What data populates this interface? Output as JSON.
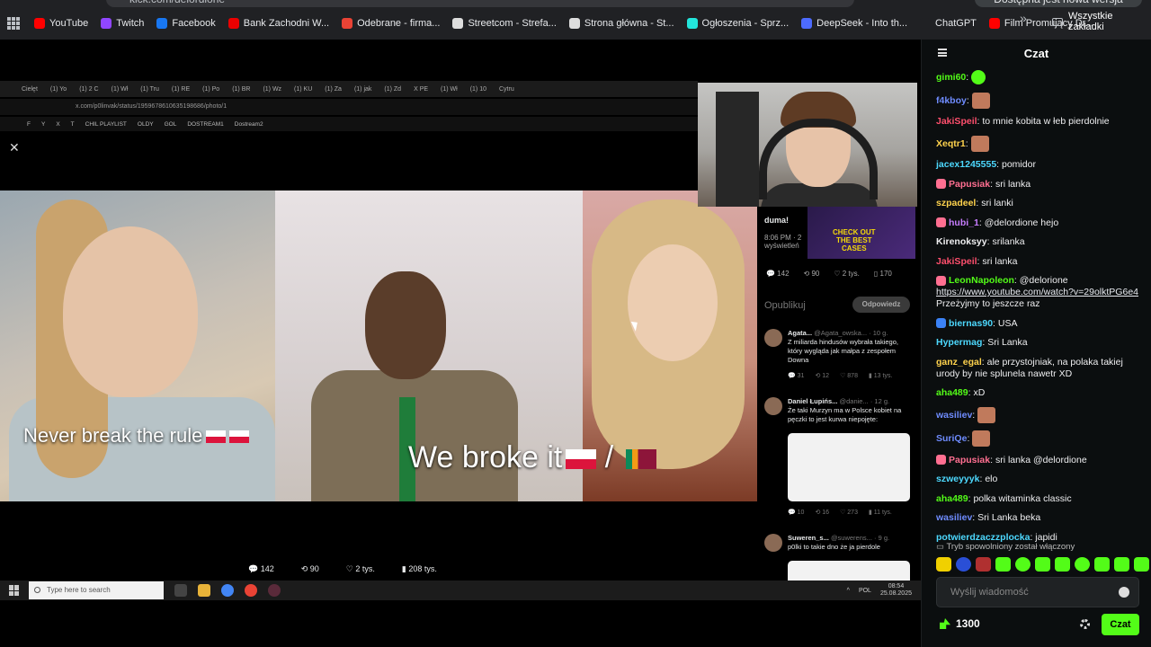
{
  "browser": {
    "url": "kick.com/delordione",
    "update_label": "Dostępna jest nowa wersja Chrome",
    "bookmarks": [
      {
        "label": "YouTube",
        "color": "#ff0000"
      },
      {
        "label": "Twitch",
        "color": "#9146ff"
      },
      {
        "label": "Facebook",
        "color": "#1877f2"
      },
      {
        "label": "Bank Zachodni W...",
        "color": "#ec0000"
      },
      {
        "label": "Odebrane - firma...",
        "color": "#ea4335"
      },
      {
        "label": "Streetcom - Strefa...",
        "color": "#dddddd"
      },
      {
        "label": "Strona główna - St...",
        "color": "#dddddd"
      },
      {
        "label": "Ogłoszenia - Sprz...",
        "color": "#23e5db"
      },
      {
        "label": "DeepSeek - Into th...",
        "color": "#4d6bfe"
      },
      {
        "label": "ChatGPT",
        "color": "#202124"
      },
      {
        "label": "Film Promujący Dr...",
        "color": "#ff0000"
      }
    ],
    "all_bookmarks": "Wszystkie zakładki"
  },
  "stream": {
    "inner_tabs": [
      "Cielęt",
      "(1) Yo",
      "(1) 2 C",
      "(1) Wł",
      "(1) Tru",
      "(1) RE",
      "(1) Po",
      "(1) BR",
      "(1) Wz",
      "(1) KU",
      "(1) Za",
      "(1) jak",
      "(1) Zd",
      "X PE",
      "(1) Wł",
      "(1) 10",
      "Cytru"
    ],
    "inner_url": "x.com/p0linvak/status/1959678610635198686/photo/1",
    "inner_bookmarks": [
      "F",
      "Y",
      "X",
      "T",
      "CHIL PLAYLIST",
      "OLDY",
      "GOL",
      "DOSTREAM1",
      "Dostream2"
    ],
    "caption_left": "Never break the rule",
    "caption_right": "We broke it",
    "tweet_side": {
      "text": "duma!",
      "time": "8:06 PM · 2",
      "views": "wyświetleń",
      "stats": [
        "142",
        "90",
        "2 tys.",
        "170"
      ],
      "publish": "Opublikuj",
      "reply_button": "Odpowiedz",
      "ad_text_1": "CHECK OUT",
      "ad_text_2": "THE BEST",
      "ad_text_3": "CASES"
    },
    "replies": [
      {
        "name": "Agata...",
        "handle": "@Agata_owska... · 10 g.",
        "text": "Z miliarda hindusów wybrała takiego, który wygląda jak małpa z zespołem Downa",
        "stats": [
          "31",
          "12",
          "878",
          "13 tys."
        ]
      },
      {
        "name": "Daniel Łupińs...",
        "handle": "@danie... · 12 g.",
        "text": "Że taki Murzyn ma w Polsce kobiet na pęczki to jest kurwa niepojęte:",
        "stats": [
          "10",
          "16",
          "273",
          "11 tys."
        ]
      },
      {
        "name": "Suweren_s...",
        "handle": "@suwerens... · 9 g.",
        "text": "p0lki to takie dno że ja pierdole",
        "stats": []
      }
    ],
    "bottom_stats": [
      "142",
      "90",
      "2 tys.",
      "208 tys."
    ],
    "taskbar": {
      "search_placeholder": "Type here to search",
      "lang": "POL",
      "time": "08:54",
      "date": "25.08.2025"
    }
  },
  "chat": {
    "title": "Czat",
    "messages": [
      {
        "user": "gimi60",
        "color": "#53fc18",
        "text": "",
        "emote": "green"
      },
      {
        "user": "f4kboy",
        "color": "#6f8cff",
        "text": "",
        "emote": "face"
      },
      {
        "user": "JakiSpeil",
        "color": "#ff4f6d",
        "text": "to mnie kobita w łeb pierdolnie"
      },
      {
        "user": "Xeqtr1",
        "color": "#ffd34d",
        "text": "",
        "emote": "face"
      },
      {
        "user": "jacex1245555",
        "color": "#4dd9ff",
        "text": "pomidor"
      },
      {
        "user": "Papusiak",
        "color": "#ff6f91",
        "text": "sri lanka",
        "badge": "#ff6f91"
      },
      {
        "user": "szpadeel",
        "color": "#ffd34d",
        "text": "sri lanki"
      },
      {
        "user": "hubi_1",
        "color": "#c77dff",
        "text": "@delordione hejo",
        "badge": "#ff6f91"
      },
      {
        "user": "Kirenoksyy",
        "color": "#efeff1",
        "text": "srilanka"
      },
      {
        "user": "JakiSpeil",
        "color": "#ff4f6d",
        "text": "sri lanka"
      },
      {
        "user": "LeonNapoleon",
        "color": "#53fc18",
        "text": "@delorione",
        "link": "https://www.youtube.com/watch?v=29olktPG6e4",
        "after": "Przeżyjmy to jeszcze raz",
        "badge": "#ff6f91"
      },
      {
        "user": "biernas90",
        "color": "#4dd9ff",
        "text": "USA",
        "badge": "#3b82f6"
      },
      {
        "user": "Hypermag",
        "color": "#4dd9ff",
        "text": "Sri Lanka"
      },
      {
        "user": "ganz_egal",
        "color": "#ffd34d",
        "text": "ale przystojniak, na polaka takiej urody by nie splunela nawetr XD"
      },
      {
        "user": "aha489",
        "color": "#53fc18",
        "text": "xD"
      },
      {
        "user": "wasiliev",
        "color": "#6f8cff",
        "text": "",
        "emote": "face"
      },
      {
        "user": "SuriQe",
        "color": "#6f8cff",
        "text": "",
        "emote": "face"
      },
      {
        "user": "Papusiak",
        "color": "#ff6f91",
        "text": "sri lanka @delordione",
        "badge": "#ff6f91"
      },
      {
        "user": "szweyyyk",
        "color": "#4dd9ff",
        "text": "elo"
      },
      {
        "user": "aha489",
        "color": "#53fc18",
        "text": "polka witaminka classic"
      },
      {
        "user": "wasiliev",
        "color": "#6f8cff",
        "text": "Sri Lanka beka"
      },
      {
        "user": "potwierdzaczzplocka",
        "color": "#4dd9ff",
        "text": "japidi"
      }
    ],
    "slow_mode": "Tryb spowolniony został włączony",
    "input_placeholder": "Wyślij wiadomość",
    "points": "1300",
    "send_label": "Czat",
    "accent": "#53fc18"
  }
}
